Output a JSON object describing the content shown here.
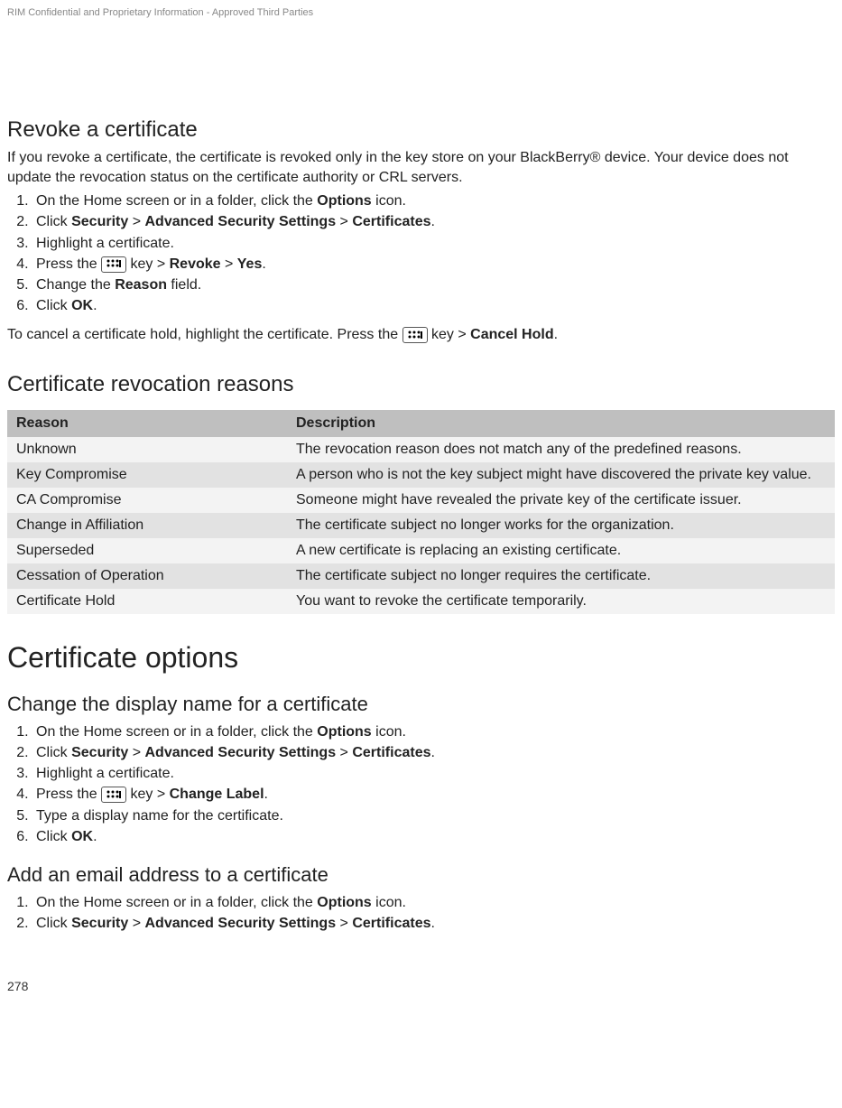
{
  "header": {
    "confidential": "RIM Confidential and Proprietary Information - Approved Third Parties"
  },
  "revoke": {
    "title": "Revoke a certificate",
    "intro": "If you revoke a certificate, the certificate is revoked only in the key store on your BlackBerry® device. Your device does not update the revocation status on the certificate authority or CRL servers.",
    "steps": {
      "s1_a": "On the Home screen or in a folder, click the ",
      "s1_b": "Options",
      "s1_c": " icon.",
      "s2_a": "Click ",
      "s2_b": "Security",
      "s2_c": " > ",
      "s2_d": "Advanced Security Settings",
      "s2_e": " > ",
      "s2_f": "Certificates",
      "s2_g": ".",
      "s3": "Highlight a certificate.",
      "s4_a": "Press the ",
      "s4_b": " key > ",
      "s4_c": "Revoke",
      "s4_d": " > ",
      "s4_e": "Yes",
      "s4_f": ".",
      "s5_a": "Change the ",
      "s5_b": "Reason",
      "s5_c": " field.",
      "s6_a": "Click ",
      "s6_b": "OK",
      "s6_c": "."
    },
    "cancel_a": "To cancel a certificate hold, highlight the certificate. Press the ",
    "cancel_b": " key > ",
    "cancel_c": "Cancel Hold",
    "cancel_d": "."
  },
  "reasons": {
    "title": "Certificate revocation reasons",
    "headers": {
      "reason": "Reason",
      "description": "Description"
    },
    "rows": [
      {
        "reason": "Unknown",
        "description": "The revocation reason does not match any of the predefined reasons."
      },
      {
        "reason": "Key Compromise",
        "description": "A person who is not the key subject might have discovered the private key value."
      },
      {
        "reason": "CA Compromise",
        "description": "Someone might have revealed the private key of the certificate issuer."
      },
      {
        "reason": "Change in Affiliation",
        "description": "The certificate subject no longer works for the organization."
      },
      {
        "reason": "Superseded",
        "description": "A new certificate is replacing an existing certificate."
      },
      {
        "reason": "Cessation of Operation",
        "description": "The certificate subject no longer requires the certificate."
      },
      {
        "reason": "Certificate Hold",
        "description": "You want to revoke the certificate temporarily."
      }
    ]
  },
  "options": {
    "title": "Certificate options"
  },
  "change_name": {
    "title": "Change the display name for a certificate",
    "steps": {
      "s1_a": "On the Home screen or in a folder, click the ",
      "s1_b": "Options",
      "s1_c": " icon.",
      "s2_a": "Click ",
      "s2_b": "Security",
      "s2_c": " > ",
      "s2_d": "Advanced Security Settings",
      "s2_e": " > ",
      "s2_f": "Certificates",
      "s2_g": ".",
      "s3": "Highlight a certificate.",
      "s4_a": "Press the ",
      "s4_b": " key > ",
      "s4_c": "Change Label",
      "s4_d": ".",
      "s5": "Type a display name for the certificate.",
      "s6_a": "Click ",
      "s6_b": "OK",
      "s6_c": "."
    }
  },
  "add_email": {
    "title": "Add an email address to a certificate",
    "steps": {
      "s1_a": "On the Home screen or in a folder, click the ",
      "s1_b": "Options",
      "s1_c": " icon.",
      "s2_a": "Click ",
      "s2_b": "Security",
      "s2_c": " > ",
      "s2_d": "Advanced Security Settings",
      "s2_e": " > ",
      "s2_f": "Certificates",
      "s2_g": "."
    }
  },
  "page_number": "278"
}
